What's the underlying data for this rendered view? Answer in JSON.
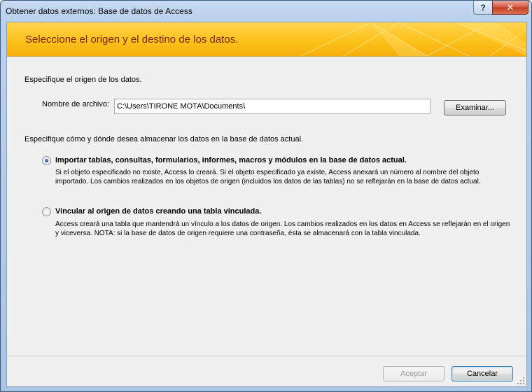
{
  "window": {
    "title": "Obtener datos externos: Base de datos de Access",
    "help_label": "?",
    "close_label": "✕"
  },
  "banner": {
    "title": "Seleccione el origen y el destino de los datos."
  },
  "source": {
    "label": "Especifique el origen de los datos.",
    "file_label": "Nombre de archivo:",
    "file_value": "C:\\Users\\TIRONE MOTA\\Documents\\",
    "browse_label": "Examinar..."
  },
  "storage": {
    "label": "Especifique cómo y dónde desea almacenar los datos en la base de datos actual.",
    "options": [
      {
        "title": "Importar tablas, consultas, formularios, informes, macros y módulos en la base de datos actual.",
        "description": "Si el objeto especificado no existe, Access lo creará. Si el objeto especificado ya existe, Access anexará un número al nombre del objeto importado. Los cambios realizados en los objetos de origen (incluidos los datos de las tablas) no se reflejarán en la base de datos actual.",
        "selected": true
      },
      {
        "title": "Vincular al origen de datos creando una tabla vinculada.",
        "description": "Access creará una tabla que mantendrá un vínculo a los datos de origen. Los cambios realizados en los datos en Access se reflejarán en el origen y viceversa. NOTA: si la base de datos de origen requiere una contraseña, ésta se almacenará con la tabla vinculada.",
        "selected": false
      }
    ]
  },
  "footer": {
    "accept_label": "Aceptar",
    "accept_enabled": false,
    "cancel_label": "Cancelar"
  },
  "colors": {
    "banner": "#fdc21c",
    "banner_text": "#7a2410",
    "close_button": "#c43c21"
  }
}
